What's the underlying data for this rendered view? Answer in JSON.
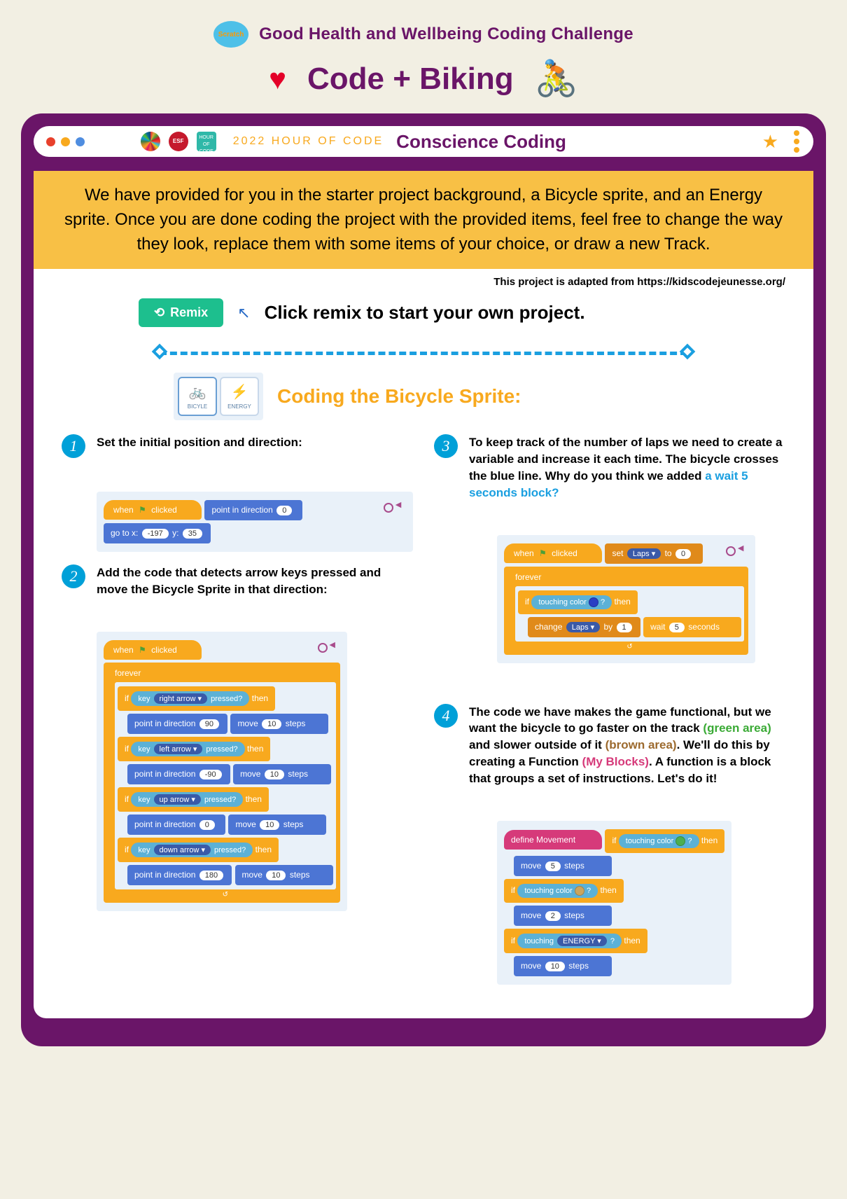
{
  "header": {
    "eyebrow": "Good Health and Wellbeing Coding Challenge",
    "title": "Code + Biking"
  },
  "browserBar": {
    "yearLabel": "2022 HOUR OF CODE",
    "title": "Conscience Coding",
    "esf": "ESF",
    "hoc": "HOUR OF CODE"
  },
  "intro": "We have provided for you in the starter project background, a Bicycle sprite, and an Energy sprite. Once you are done coding the project with the provided items, feel free to change the way they look, replace them with some items of your choice, or draw a new Track.",
  "adapted": "This project is adapted from https://kidscodejeunesse.org/",
  "remix": {
    "button": "Remix",
    "text": "Click remix to start your own project."
  },
  "section": {
    "title": "Coding the Bicycle Sprite:",
    "spriteA": "BICYLE",
    "spriteB": "ENERGY"
  },
  "steps": {
    "s1": {
      "num": "1",
      "text": "Set the initial position and direction:",
      "code": {
        "when": "when",
        "clicked": "clicked",
        "point": "point in direction",
        "dir": "0",
        "goto": "go to x:",
        "x": "-197",
        "ylabel": "y:",
        "y": "35"
      }
    },
    "s2": {
      "num": "2",
      "text": "Add the code that detects arrow keys pressed and move the Bicycle Sprite in that direction:",
      "code": {
        "when": "when",
        "clicked": "clicked",
        "forever": "forever",
        "if": "if",
        "key": "key",
        "pressed": "pressed?",
        "then": "then",
        "right": "right arrow ▾",
        "left": "left arrow ▾",
        "up": "up arrow ▾",
        "down": "down arrow ▾",
        "point": "point in direction",
        "d90": "90",
        "dn90": "-90",
        "d0": "0",
        "d180": "180",
        "move": "move",
        "steps": "steps",
        "ten": "10"
      }
    },
    "s3": {
      "num": "3",
      "text": "To keep track of the number of laps we need to create a variable and increase it each time. The bicycle crosses the blue line. Why do you think we added ",
      "hl": "a wait 5 seconds block?",
      "code": {
        "when": "when",
        "clicked": "clicked",
        "set": "set",
        "laps": "Laps ▾",
        "to": "to",
        "zero": "0",
        "forever": "forever",
        "if": "if",
        "touching": "touching color",
        "q": "?",
        "then": "then",
        "change": "change",
        "by": "by",
        "one": "1",
        "wait": "wait",
        "five": "5",
        "seconds": "seconds"
      }
    },
    "s4": {
      "num": "4",
      "textA": "The code we have makes the game functional, but we want the bicycle to go faster on the track ",
      "green": "(green area)",
      "textB": " and slower outside of it ",
      "brown": "(brown area)",
      "textC": ". We'll do this by creating a Function ",
      "pink": "(My Blocks)",
      "textD": ". A function is a block that groups a set of instructions. Let's do it!",
      "code": {
        "define": "define  Movement",
        "if": "if",
        "touching": "touching color",
        "q": "?",
        "then": "then",
        "move": "move",
        "steps": "steps",
        "five": "5",
        "two": "2",
        "ten": "10",
        "touchingSprite": "touching",
        "energy": "ENERGY ▾"
      }
    }
  }
}
